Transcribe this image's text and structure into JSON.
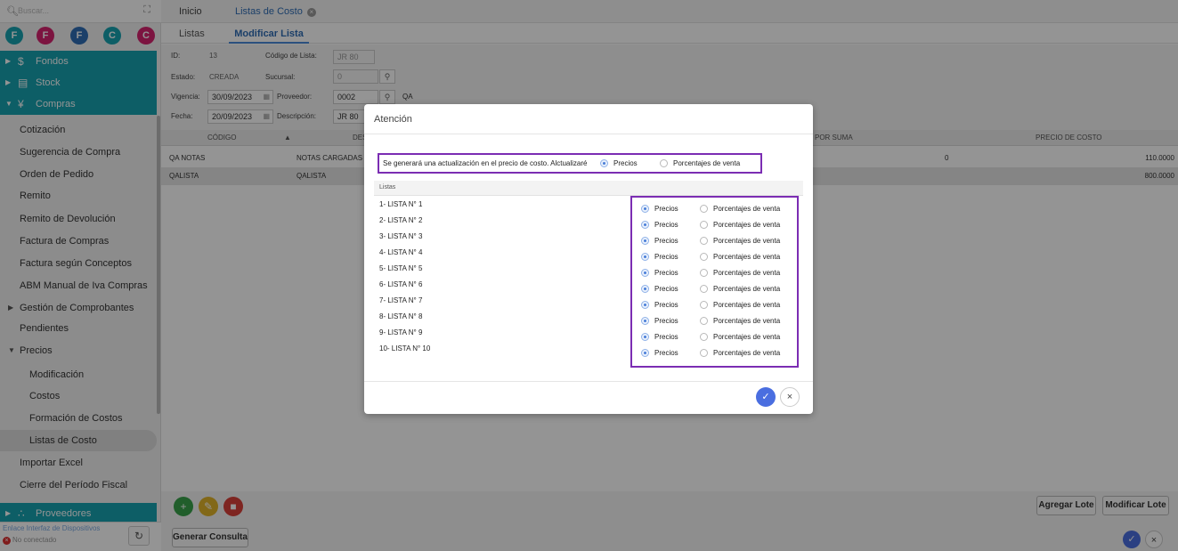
{
  "sidebar": {
    "search_placeholder": "Buscar...",
    "shortcuts": [
      {
        "letter": "F",
        "color": "#17a2b0"
      },
      {
        "letter": "F",
        "color": "#d6246e"
      },
      {
        "letter": "F",
        "color": "#2f6db5"
      },
      {
        "letter": "C",
        "color": "#17a2b0"
      },
      {
        "letter": "C",
        "color": "#d6246e"
      }
    ],
    "sections": {
      "fondos": "Fondos",
      "stock": "Stock",
      "compras": "Compras",
      "proveedores": "Proveedores"
    },
    "items": [
      "Cotización",
      "Sugerencia de Compra",
      "Orden de Pedido",
      "Remito",
      "Remito de Devolución",
      "Factura de Compras",
      "Factura según Conceptos",
      "ABM Manual de Iva Compras",
      "Gestión de Comprobantes",
      "Pendientes",
      "Precios",
      "Modificación",
      "Costos",
      "Formación de Costos",
      "Listas de Costo",
      "Importar Excel",
      "Cierre del Período Fiscal"
    ],
    "device_link": "Enlace Interfaz de Dispositivos",
    "device_status": "No conectado"
  },
  "tabs": {
    "home": "Inicio",
    "current": "Listas de Costo"
  },
  "subtabs": {
    "list": "Listas",
    "edit": "Modificar Lista"
  },
  "form": {
    "id_label": "ID:",
    "id_value": "13",
    "code_label": "Código de Lista:",
    "code_value": "JR 80",
    "estado_label": "Estado:",
    "estado_value": "CREADA",
    "sucursal_label": "Sucursal:",
    "sucursal_value": "0",
    "vigencia_label": "Vigencia:",
    "vigencia_value": "30/09/2023",
    "proveedor_label": "Proveedor:",
    "proveedor_code": "0002",
    "proveedor_name": "QA",
    "fecha_label": "Fecha:",
    "fecha_value": "20/09/2023",
    "descripcion_label": "Descripción:",
    "descripcion_value": "JR 80"
  },
  "grid": {
    "headers": {
      "codigo": "CÓDIGO",
      "desc": "DES",
      "suma": "POR SUMA",
      "precio": "PRECIO DE COSTO"
    },
    "rows": [
      {
        "codigo": "QA NOTAS",
        "desc": "NOTAS CARGADAS",
        "suma": "0",
        "precio": "110.0000"
      },
      {
        "codigo": "QALISTA",
        "desc": "QALISTA",
        "suma": "",
        "precio": "800.0000"
      }
    ]
  },
  "bottom": {
    "agregar": "Agregar Lote",
    "modificar": "Modificar Lote",
    "generar": "Generar Consulta"
  },
  "modal": {
    "title": "Atención",
    "question": "Se generará una actualización en el precio de costo. Alctualizaré",
    "opt_precios": "Precios",
    "opt_porcentajes": "Porcentajes de venta",
    "list_header": "Listas",
    "lists": [
      "1- LISTA N° 1",
      "2- LISTA N° 2",
      "3- LISTA N° 3",
      "4- LISTA N° 4",
      "5- LISTA N° 5",
      "6- LISTA N° 6",
      "7- LISTA N° 7",
      "8- LISTA N° 8",
      "9- LISTA N° 9",
      "10- LISTA N° 10"
    ]
  }
}
